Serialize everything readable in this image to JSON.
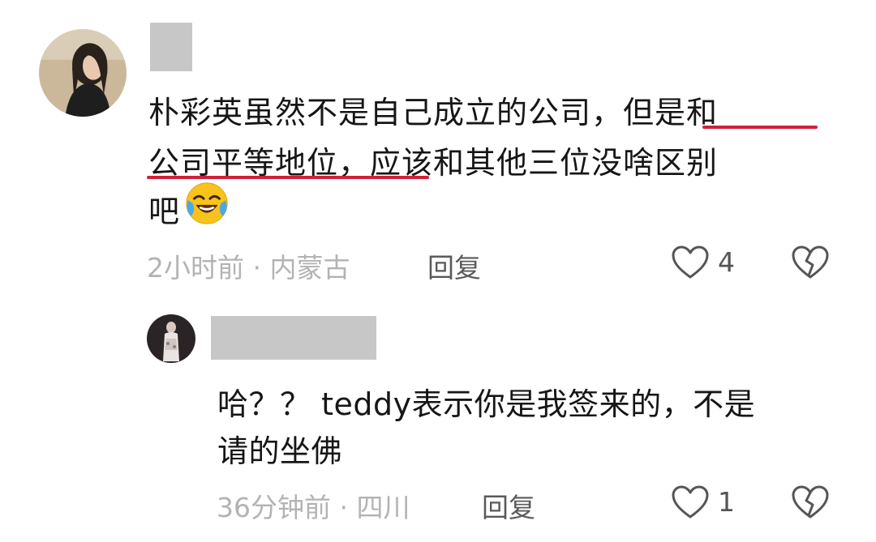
{
  "comment": {
    "text_lines": [
      "朴彩英虽然不是自己成立的公司，但是和",
      "公司平等地位，应该和其他三位没啥区别",
      "吧"
    ],
    "emoji": "laughing-crying-emoji",
    "meta": "2小时前 · 内蒙古",
    "reply_label": "回复",
    "like_count": "4"
  },
  "reply": {
    "text_lines": [
      "哈？？ teddy表示你是我签来的，不是",
      "请的坐佛"
    ],
    "meta": "36分钟前 · 四川",
    "reply_label": "回复",
    "like_count": "1"
  },
  "colors": {
    "underline": "#d0213a",
    "meta": "#b3b3b3",
    "redaction": "#c7c7c7"
  },
  "icons": {
    "like": "heart-outline-icon",
    "dislike": "broken-heart-icon"
  }
}
